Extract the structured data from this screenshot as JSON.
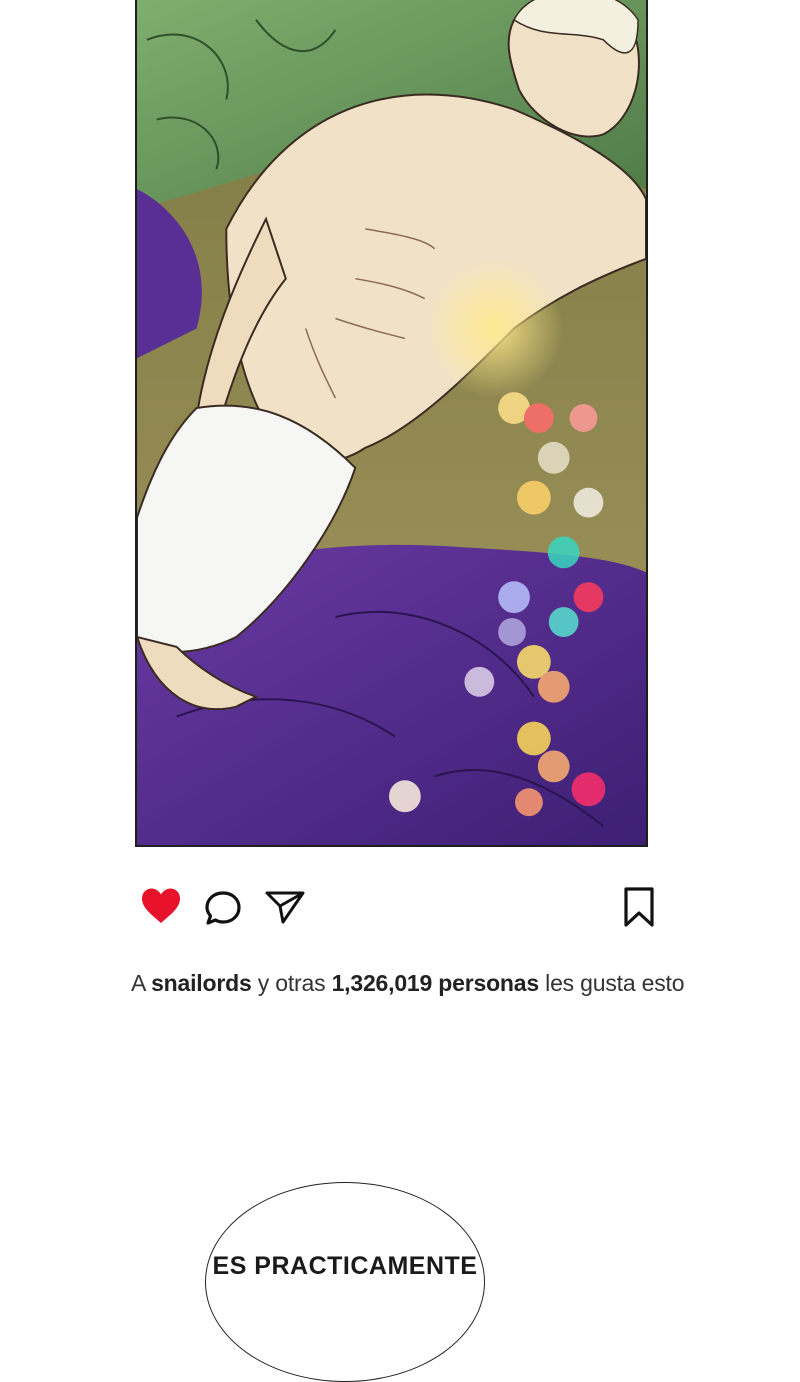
{
  "post": {
    "image": {
      "description_icon": "illustration"
    },
    "actions": {
      "like_icon": "heart-filled-icon",
      "comment_icon": "comment-bubble-icon",
      "share_icon": "paper-plane-icon",
      "save_icon": "bookmark-icon",
      "like_color": "#e8132b"
    },
    "likes": {
      "prefix": "A",
      "user": "snailords",
      "middle": "y otras",
      "count": "1,326,019 personas",
      "suffix": "les gusta esto"
    }
  },
  "speech_bubble": {
    "text": "ES PRACTICAMENTE"
  }
}
